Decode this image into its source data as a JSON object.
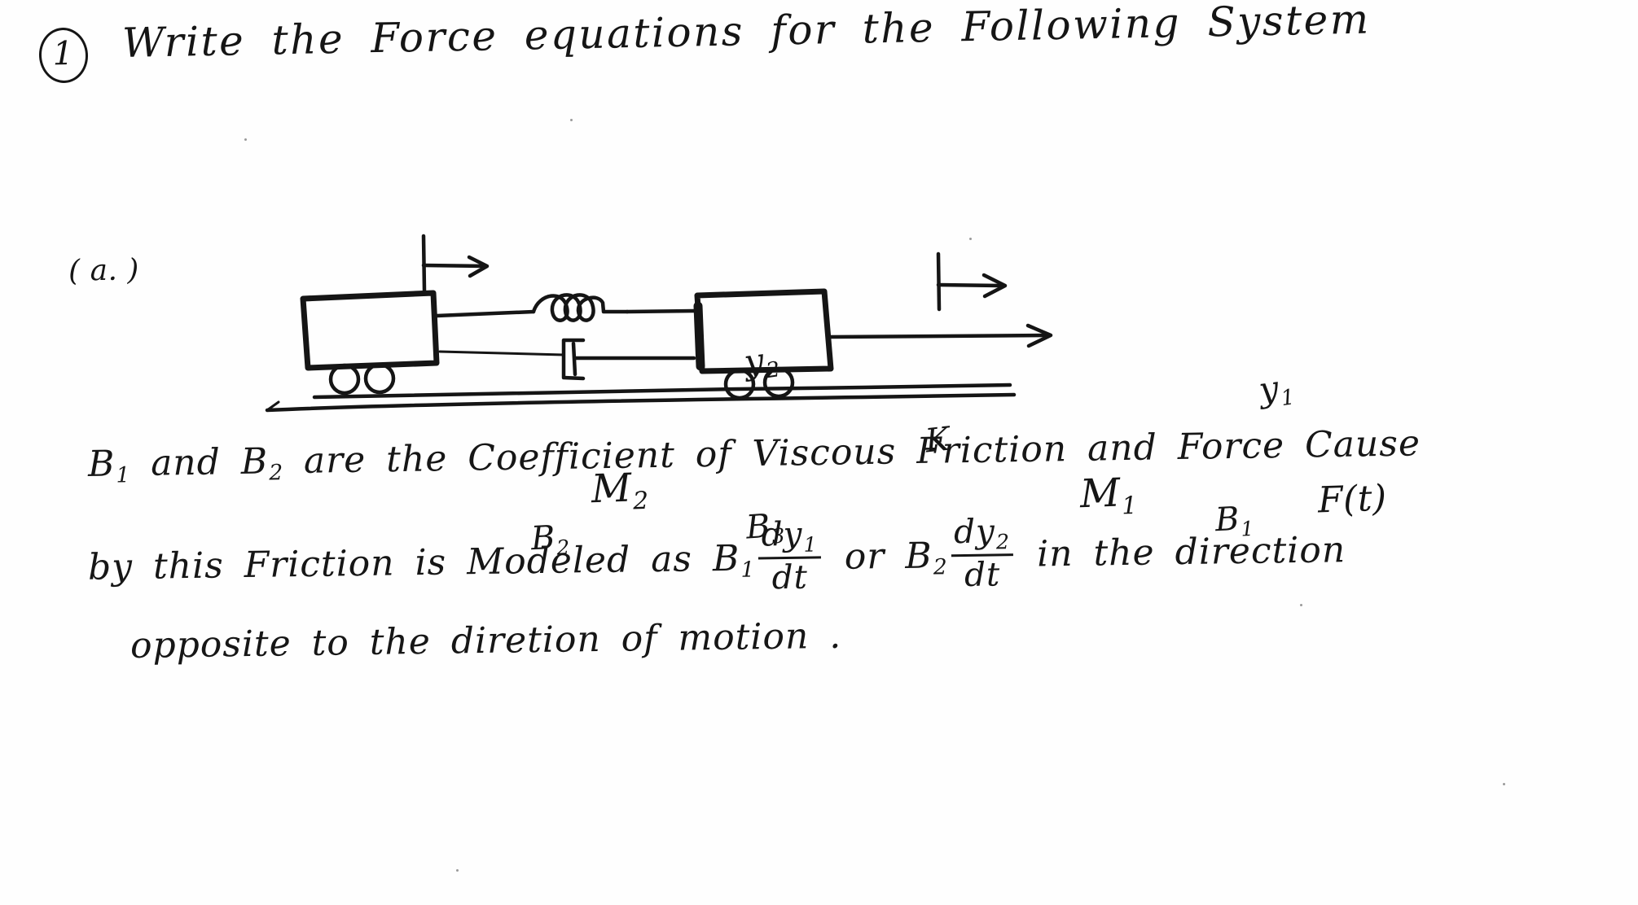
{
  "document": {
    "kind": "handwritten-homework-scan",
    "ink_color": "#151515",
    "paper_color": "#fefefe"
  },
  "problem": {
    "number": "1",
    "title": "Write the Force equations for the Following System",
    "part_label": "( a. )"
  },
  "diagram": {
    "caption_labels": {
      "displacement_right": "y",
      "displacement_right_sub": "1",
      "displacement_left": "y",
      "displacement_left_sub": "2",
      "spring": "K",
      "mass_right": "M",
      "mass_right_sub": "1",
      "mass_left": "M",
      "mass_left_sub": "2",
      "damper_between": "B",
      "damper_between_sub": "3",
      "friction_right": "B",
      "friction_right_sub": "1",
      "friction_left": "B",
      "friction_left_sub": "2",
      "applied_force": "F(t)"
    },
    "elements": {
      "mass_blocks": 2,
      "wheels_per_block": 2,
      "spring_coils": 3,
      "dampers": 1,
      "ground_line": true,
      "force_arrow_direction": "right"
    }
  },
  "body": {
    "line1_a": "B",
    "line1_a_sub": "1",
    "line1_b": " and ",
    "line1_c": "B",
    "line1_c_sub": "2",
    "line1_d": " are the Coefficient of Viscous Friction and Force Cause",
    "line2_a": "by this Friction is Modeled as ",
    "line2_b": "B",
    "line2_b_sub": "1",
    "line2_frac1_num": "dy",
    "line2_frac1_num_sub": "1",
    "line2_frac1_den": "dt",
    "line2_c": " or ",
    "line2_d": "B",
    "line2_d_sub": "2",
    "line2_frac2_num": "dy",
    "line2_frac2_num_sub": "2",
    "line2_frac2_den": "dt",
    "line2_e": " in the direction",
    "line3": "opposite to the diretion of motion ."
  }
}
